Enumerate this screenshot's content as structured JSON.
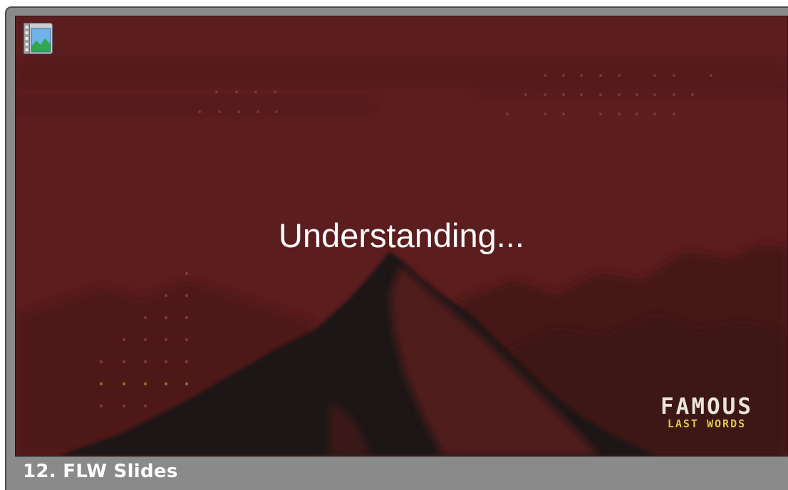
{
  "slide": {
    "text": "Understanding...",
    "logo_line1": "FAMOUS",
    "logo_line2": "LAST WORDS"
  },
  "caption": "12. FLW Slides",
  "icons": {
    "media": "media-image-icon"
  },
  "colors": {
    "slide_bg": "#5c1d1f",
    "frame_bg": "#8a8a8a",
    "mountain": "#1c1616",
    "logo_accent": "#d9c74a"
  }
}
